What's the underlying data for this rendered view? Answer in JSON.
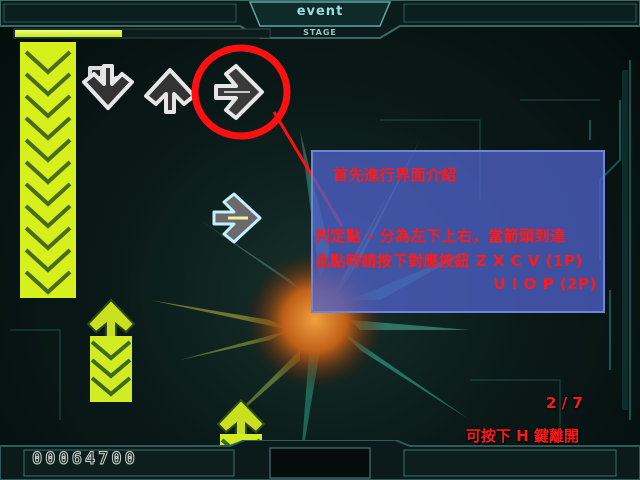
{
  "header": {
    "mode_label": "event",
    "stage_label": "STAGE"
  },
  "tutorial": {
    "title": "首先進行界面介紹",
    "line1": "判定點 - 分為左下上右，當箭頭到達",
    "line2": "此點時請按下對應按鈕 Z X C V (1P)",
    "line3": "U I O P (2P)"
  },
  "page_indicator": "2 / 7",
  "exit_hint": "可按下 H 鍵離開",
  "score": "00064700",
  "life_gauge_level": 0.42,
  "colors": {
    "highlight_circle": "#ff1010",
    "panel": "#4e60c8",
    "text": "#ff1a1a",
    "arrow_yellow": "#d8f020",
    "arrow_green": "#2f5a1a"
  }
}
